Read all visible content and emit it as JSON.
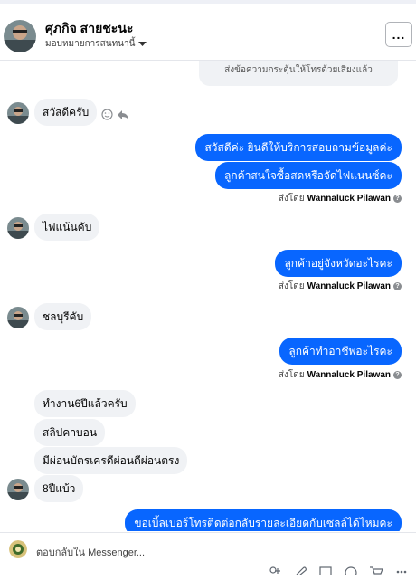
{
  "header": {
    "name": "ศุภกิจ สายชะนะ",
    "assignee": "มอบหมายการสนทนานี้",
    "more_label": "..."
  },
  "system_note": "ส่งข้อความกระตุ้นให้โทรด้วยเสียงแล้ว",
  "messages": {
    "in1": "สวัสดีครับ",
    "out1": "สวัสดีค่ะ  ยินดีให้บริการสอบถามข้อมูลค่ะ",
    "out2": "ลูกค้าสนใจซื้อสดหรือจัดไฟแนนซ์คะ",
    "in2": "ไฟแน้นคับ",
    "out3": "ลูกค้าอยู่จังหวัดอะไรคะ",
    "in3": "ชลบุรีคับ",
    "out4": "ลูกค้าทำอาชีพอะไรคะ",
    "in4": "ทำงาน6ปีแล้วครับ",
    "in5": "สลิปคาบอน",
    "in6": "มีผ่อนบัตรเครดีผ่อนดีผ่อนตรง",
    "in7": "8ปีแบ้ว",
    "out5": "ขอเบิ้ลเบอร์โทรติดต่อกลับรายละเอียดกับเซลล์ได้ไหมคะ"
  },
  "sent_by": {
    "prefix": "ส่งโดย",
    "agent": "Wannaluck Pilawan"
  },
  "composer": {
    "placeholder": "ตอบกลับใน Messenger..."
  },
  "colors": {
    "accent": "#0866ff",
    "incoming_bubble": "#f0f2f5"
  }
}
